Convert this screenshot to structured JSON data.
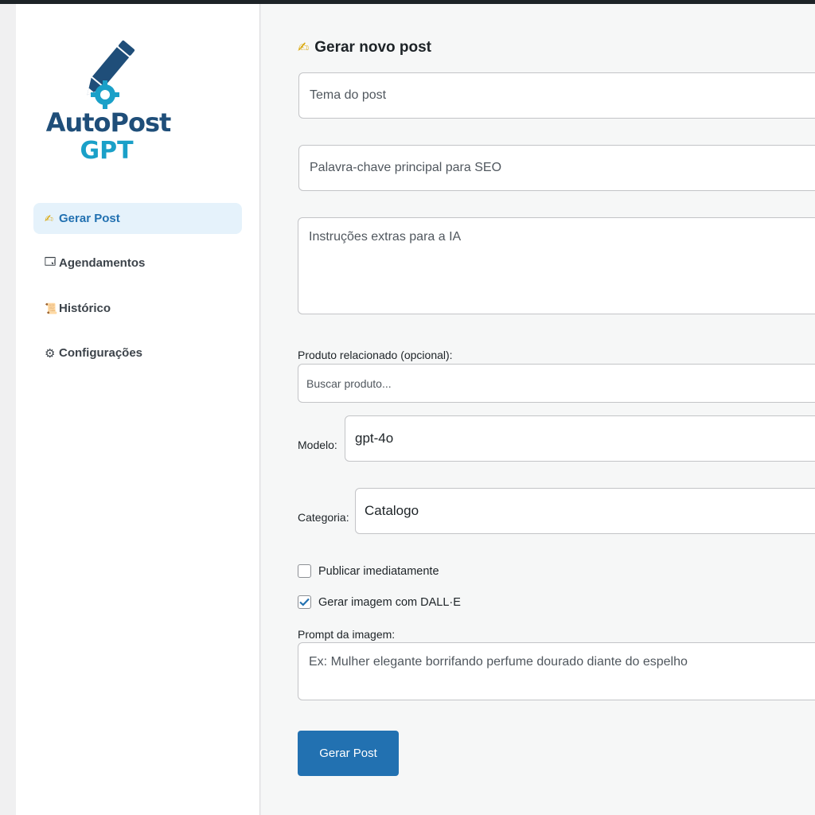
{
  "brand": {
    "name_line1": "AutoPost",
    "name_line2": "GPT",
    "colors": {
      "primary": "#1f4e79",
      "accent": "#1aa0c8"
    }
  },
  "sidebar": {
    "items": [
      {
        "icon": "writing-hand-icon",
        "glyph": "✍",
        "label": "Gerar Post",
        "active": true
      },
      {
        "icon": "calendar-icon",
        "glyph": "🗔",
        "label": "Agendamentos",
        "active": false
      },
      {
        "icon": "scroll-icon",
        "glyph": "📜",
        "label": "Histórico",
        "active": false
      },
      {
        "icon": "gear-icon",
        "glyph": "⚙",
        "label": "Configurações",
        "active": false
      }
    ]
  },
  "form": {
    "title_icon": "✍",
    "title": "Gerar novo post",
    "topic_placeholder": "Tema do post",
    "keyword_placeholder": "Palavra-chave principal para SEO",
    "instructions_placeholder": "Instruções extras para a IA",
    "product_label": "Produto relacionado (opcional):",
    "product_placeholder": "Buscar produto...",
    "model_label": "Modelo:",
    "model_value": "gpt-4o",
    "category_label": "Categoria:",
    "category_value": "Catalogo",
    "publish_label": "Publicar imediatamente",
    "publish_checked": false,
    "dalle_label": "Gerar imagem com DALL·E",
    "dalle_checked": true,
    "image_prompt_label": "Prompt da imagem:",
    "image_prompt_placeholder": "Ex: Mulher elegante borrifando perfume dourado diante do espelho",
    "submit_label": "Gerar Post"
  },
  "colors": {
    "button": "#2271b1",
    "active_nav_bg": "#e5f2fb",
    "active_nav_text": "#2271b1"
  }
}
